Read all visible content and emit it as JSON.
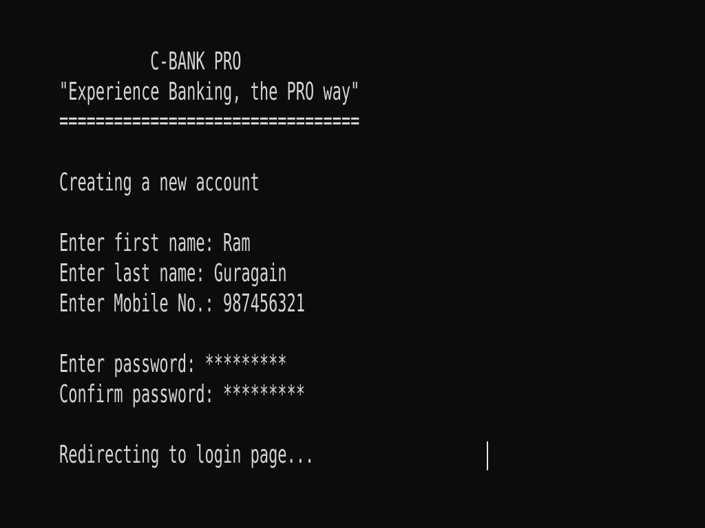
{
  "window": {
    "background": "#0c0c0c",
    "foreground": "#d4d4d4"
  },
  "terminal": {
    "title_line": "          C-BANK PRO",
    "slogan_line": "\"Experience Banking, the PRO way\"",
    "separator_line": "=================================",
    "heading_line": "Creating a new account",
    "first_name_prompt": "Enter first name: ",
    "first_name_value": "Ram",
    "last_name_prompt": "Enter last name: ",
    "last_name_value": "Guragain",
    "mobile_prompt": "Enter Mobile No.: ",
    "mobile_value": "987456321",
    "password_prompt": "Enter password: ",
    "password_value": "*********",
    "confirm_prompt": "Confirm password: ",
    "confirm_value": "*********",
    "status_line": "Redirecting to login page..."
  }
}
